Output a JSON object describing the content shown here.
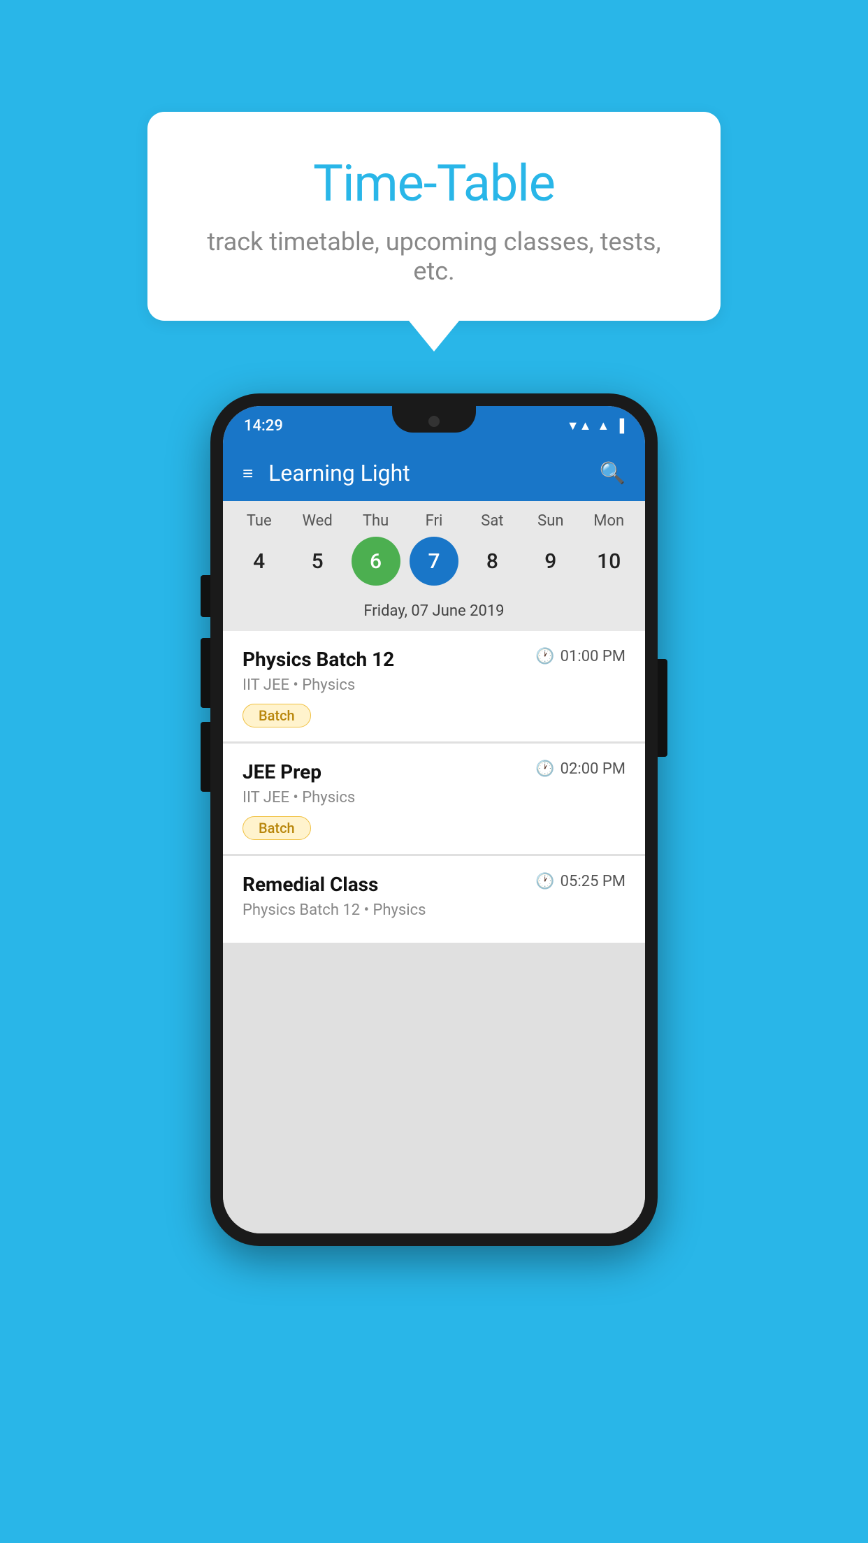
{
  "page": {
    "background_color": "#29B6E8"
  },
  "speech_bubble": {
    "title": "Time-Table",
    "subtitle": "track timetable, upcoming classes, tests, etc."
  },
  "status_bar": {
    "time": "14:29",
    "wifi": "▼▲",
    "signal": "▲"
  },
  "app_header": {
    "title": "Learning Light",
    "menu_icon": "≡",
    "search_icon": "🔍"
  },
  "calendar": {
    "days": [
      {
        "label": "Tue",
        "num": "4"
      },
      {
        "label": "Wed",
        "num": "5"
      },
      {
        "label": "Thu",
        "num": "6",
        "state": "today"
      },
      {
        "label": "Fri",
        "num": "7",
        "state": "selected"
      },
      {
        "label": "Sat",
        "num": "8"
      },
      {
        "label": "Sun",
        "num": "9"
      },
      {
        "label": "Mon",
        "num": "10"
      }
    ],
    "selected_date_label": "Friday, 07 June 2019"
  },
  "schedule": {
    "items": [
      {
        "title": "Physics Batch 12",
        "time": "01:00 PM",
        "subtitle": "IIT JEE • Physics",
        "tag": "Batch"
      },
      {
        "title": "JEE Prep",
        "time": "02:00 PM",
        "subtitle": "IIT JEE • Physics",
        "tag": "Batch"
      },
      {
        "title": "Remedial Class",
        "time": "05:25 PM",
        "subtitle": "Physics Batch 12 • Physics",
        "tag": null
      }
    ]
  }
}
